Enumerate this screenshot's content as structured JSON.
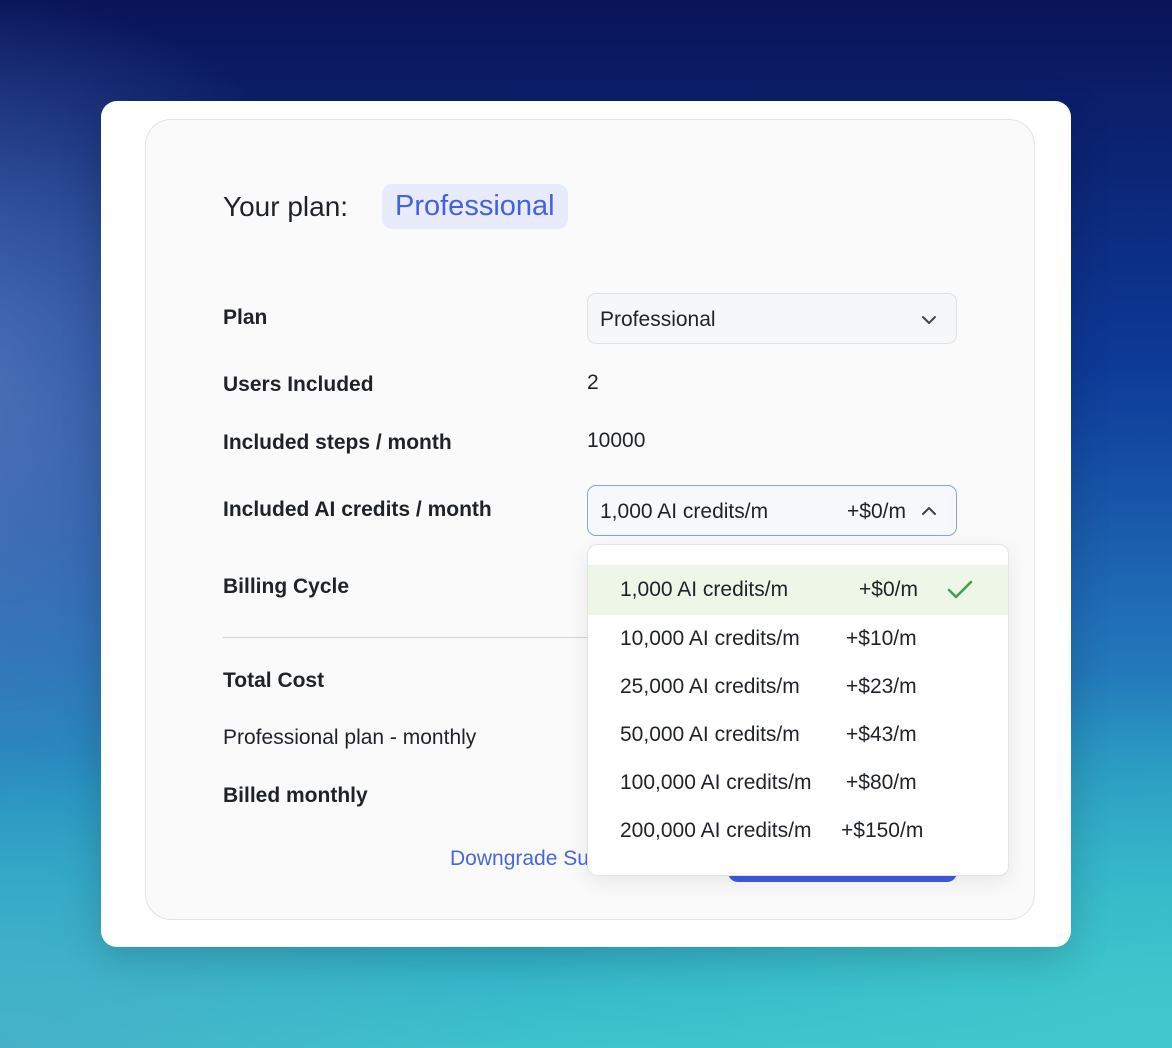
{
  "header": {
    "label": "Your plan:",
    "plan_badge": "Professional"
  },
  "rows": {
    "plan": {
      "label": "Plan",
      "value": "Professional"
    },
    "users": {
      "label": "Users Included",
      "value": "2"
    },
    "steps": {
      "label": "Included steps / month",
      "value": "10000"
    },
    "ai_credits": {
      "label": "Included AI credits / month",
      "value": "1,000 AI credits/m",
      "price": "+$0/m"
    },
    "billing_cycle": {
      "label": "Billing Cycle"
    }
  },
  "summary": {
    "total_cost": "Total Cost",
    "plan_line": "Professional plan - monthly",
    "billed": "Billed monthly"
  },
  "actions": {
    "downgrade_link": "Downgrade Su"
  },
  "dropdown": {
    "options": [
      {
        "label": "1,000 AI credits/m",
        "price": "+$0/m",
        "selected": true
      },
      {
        "label": "10,000 AI credits/m",
        "price": "+$10/m",
        "selected": false
      },
      {
        "label": "25,000 AI credits/m",
        "price": "+$23/m",
        "selected": false
      },
      {
        "label": "50,000 AI credits/m",
        "price": "+$43/m",
        "selected": false
      },
      {
        "label": "100,000 AI credits/m",
        "price": "+$80/m",
        "selected": false
      },
      {
        "label": "200,000 AI credits/m",
        "price": "+$150/m",
        "selected": false
      }
    ]
  },
  "colors": {
    "accent": "#4461e0",
    "selected_bg": "#eef6e8",
    "check": "#3fa34d"
  },
  "icons": {
    "plan_select": "chevron-down-icon",
    "credits_select": "chevron-up-icon",
    "selected_option": "check-icon"
  }
}
